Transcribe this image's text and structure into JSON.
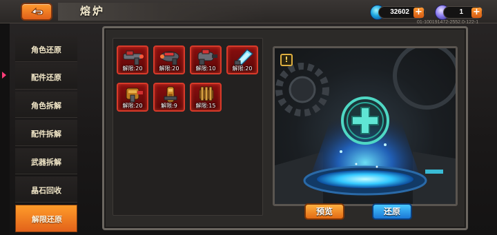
{
  "header": {
    "title": "熔炉",
    "back_icon": "back-arrow-icon"
  },
  "resources": [
    {
      "icon": "gem-icon",
      "amount": "32602",
      "plus": "+"
    },
    {
      "icon": "orb-icon",
      "amount": "1",
      "plus": "+"
    }
  ],
  "server_id": "01-100191472-2552.0-122-1",
  "sidebar": {
    "items": [
      {
        "label": "角色还原",
        "active": false
      },
      {
        "label": "配件还原",
        "active": false
      },
      {
        "label": "角色拆解",
        "active": false
      },
      {
        "label": "配件拆解",
        "active": false
      },
      {
        "label": "武器拆解",
        "active": false
      },
      {
        "label": "晶石回收",
        "active": false
      },
      {
        "label": "解限还原",
        "active": true
      }
    ]
  },
  "inventory": [
    {
      "icon": "blaster-icon",
      "label": "解限:20"
    },
    {
      "icon": "blaster-icon",
      "label": "解限:20"
    },
    {
      "icon": "blaster-icon",
      "label": "解限:10"
    },
    {
      "icon": "crystal-gun-icon",
      "label": "解限:20"
    },
    {
      "icon": "shotgun-icon",
      "label": "解限:20"
    },
    {
      "icon": "cannon-icon",
      "label": "解限:9"
    },
    {
      "icon": "gatling-icon",
      "label": "解限:15"
    }
  ],
  "stage": {
    "warning": "!",
    "center_icon": "plus-icon"
  },
  "buttons": {
    "preview": "预览",
    "restore": "还原"
  },
  "colors": {
    "accent_orange": "#e2621a",
    "accent_blue": "#1a78d6",
    "slot_red": "#d83a2a",
    "portal_cyan": "#3fe0ff"
  }
}
